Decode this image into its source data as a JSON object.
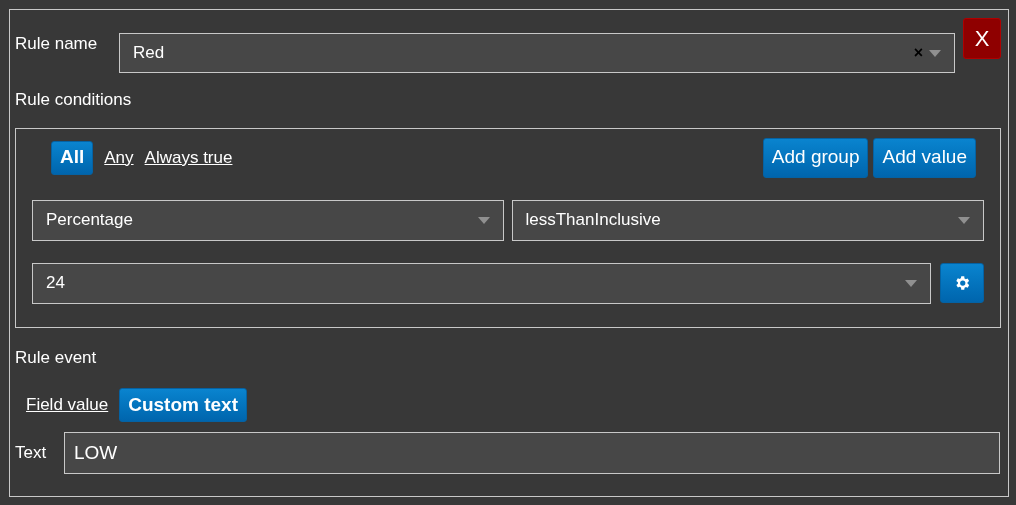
{
  "close_button": "X",
  "rule_name": {
    "label": "Rule name",
    "value": "Red",
    "clear": "×"
  },
  "conditions": {
    "label": "Rule conditions",
    "modes": [
      {
        "label": "All",
        "selected": true
      },
      {
        "label": "Any",
        "selected": false
      },
      {
        "label": "Always true",
        "selected": false
      }
    ],
    "buttons": [
      "Add group",
      "Add value"
    ],
    "field": "Percentage",
    "operator": "lessThanInclusive",
    "value": "24"
  },
  "event": {
    "label": "Rule event",
    "modes": [
      {
        "label": "Field value",
        "selected": false
      },
      {
        "label": "Custom text",
        "selected": true
      }
    ],
    "text_label": "Text",
    "text_value": "LOW"
  }
}
